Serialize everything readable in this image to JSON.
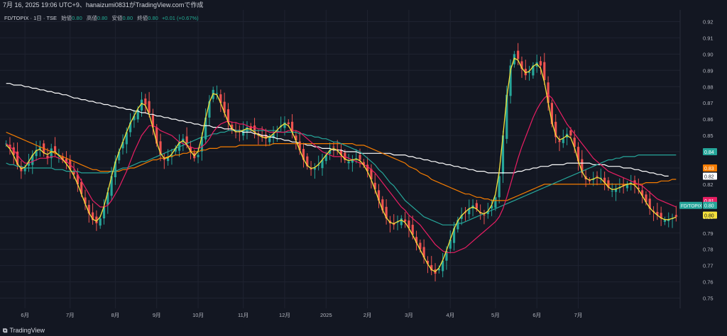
{
  "header": {
    "title": "7月 16, 2025 19:06 UTC+9、hanaizumi0831がTradingView.comで作成"
  },
  "legend": {
    "symbol": "FD/TOPIX · 1日 · TSE",
    "open_label": "始値",
    "open_value": "0.80",
    "high_label": "高値",
    "high_value": "0.80",
    "low_label": "安値",
    "low_value": "0.80",
    "close_label": "終値",
    "close_value": "0.80",
    "change": "+0.01 (+0.67%)"
  },
  "footer": {
    "brand": "TradingView",
    "icon": "tradingview-logo-icon"
  },
  "colors": {
    "background": "#131722",
    "grid": "#1f2330",
    "up": "#26a69a",
    "down": "#ef5350",
    "ma5": "#f5e13c",
    "ma25": "#e91e63",
    "ma75": "#26a69a",
    "ma100": "#f57c00",
    "ma200": "#ffffff"
  },
  "chart_data": {
    "type": "candlestick",
    "ylim": [
      0.745,
      0.925
    ],
    "yticks": [
      "0.92",
      "0.91",
      "0.90",
      "0.89",
      "0.88",
      "0.87",
      "0.86",
      "0.85",
      "0.84",
      "0.83",
      "0.82",
      "0.81",
      "0.80",
      "0.79",
      "0.78",
      "0.77",
      "0.76",
      "0.75"
    ],
    "xticks": [
      "6月",
      "7月",
      "8月",
      "9月",
      "10月",
      "11月",
      "12月",
      "2025",
      "2月",
      "3月",
      "4月",
      "5月",
      "6月",
      "7月"
    ],
    "closes": [
      0.845,
      0.842,
      0.838,
      0.832,
      0.828,
      0.83,
      0.834,
      0.838,
      0.841,
      0.843,
      0.839,
      0.836,
      0.842,
      0.84,
      0.838,
      0.835,
      0.833,
      0.829,
      0.826,
      0.82,
      0.814,
      0.808,
      0.802,
      0.798,
      0.796,
      0.799,
      0.806,
      0.815,
      0.825,
      0.834,
      0.84,
      0.846,
      0.852,
      0.858,
      0.862,
      0.866,
      0.872,
      0.869,
      0.864,
      0.855,
      0.845,
      0.838,
      0.835,
      0.836,
      0.838,
      0.842,
      0.846,
      0.848,
      0.845,
      0.84,
      0.836,
      0.838,
      0.849,
      0.861,
      0.871,
      0.878,
      0.876,
      0.87,
      0.864,
      0.858,
      0.853,
      0.852,
      0.852,
      0.853,
      0.855,
      0.854,
      0.852,
      0.85,
      0.849,
      0.848,
      0.849,
      0.851,
      0.853,
      0.856,
      0.858,
      0.857,
      0.852,
      0.847,
      0.841,
      0.835,
      0.831,
      0.829,
      0.83,
      0.832,
      0.835,
      0.838,
      0.841,
      0.843,
      0.841,
      0.838,
      0.835,
      0.834,
      0.835,
      0.836,
      0.835,
      0.832,
      0.828,
      0.823,
      0.817,
      0.81,
      0.804,
      0.799,
      0.796,
      0.795,
      0.797,
      0.799,
      0.797,
      0.793,
      0.789,
      0.784,
      0.78,
      0.775,
      0.771,
      0.767,
      0.765,
      0.768,
      0.773,
      0.779,
      0.786,
      0.793,
      0.798,
      0.801,
      0.803,
      0.805,
      0.807,
      0.805,
      0.802,
      0.801,
      0.803,
      0.807,
      0.812,
      0.825,
      0.85,
      0.875,
      0.893,
      0.9,
      0.897,
      0.891,
      0.887,
      0.889,
      0.893,
      0.895,
      0.893,
      0.884,
      0.87,
      0.857,
      0.849,
      0.846,
      0.848,
      0.851,
      0.85,
      0.843,
      0.834,
      0.827,
      0.823,
      0.822,
      0.823,
      0.825,
      0.824,
      0.821,
      0.818,
      0.816,
      0.817,
      0.818,
      0.819,
      0.82,
      0.821,
      0.82,
      0.817,
      0.813,
      0.809,
      0.805,
      0.803,
      0.801,
      0.799,
      0.798,
      0.798,
      0.799,
      0.8
    ],
    "series": [
      {
        "name": "",
        "color": "#e91e63",
        "values": [
          0.845,
          0.843,
          0.841,
          0.838,
          0.835,
          0.833,
          0.833,
          0.834,
          0.835,
          0.836,
          0.836,
          0.836,
          0.837,
          0.837,
          0.836,
          0.835,
          0.834,
          0.832,
          0.83,
          0.826,
          0.822,
          0.818,
          0.814,
          0.81,
          0.808,
          0.806,
          0.806,
          0.807,
          0.81,
          0.814,
          0.818,
          0.823,
          0.828,
          0.834,
          0.84,
          0.845,
          0.85,
          0.853,
          0.856,
          0.856,
          0.855,
          0.853,
          0.852,
          0.851,
          0.85,
          0.848,
          0.846,
          0.845,
          0.844,
          0.843,
          0.842,
          0.842,
          0.843,
          0.845,
          0.848,
          0.852,
          0.855,
          0.857,
          0.858,
          0.859,
          0.858,
          0.858,
          0.857,
          0.857,
          0.856,
          0.855,
          0.855,
          0.854,
          0.854,
          0.853,
          0.852,
          0.852,
          0.852,
          0.852,
          0.852,
          0.853,
          0.853,
          0.853,
          0.852,
          0.85,
          0.848,
          0.846,
          0.844,
          0.842,
          0.84,
          0.839,
          0.838,
          0.837,
          0.837,
          0.837,
          0.837,
          0.836,
          0.835,
          0.834,
          0.833,
          0.832,
          0.831,
          0.829,
          0.827,
          0.824,
          0.821,
          0.818,
          0.815,
          0.812,
          0.809,
          0.806,
          0.804,
          0.801,
          0.799,
          0.797,
          0.795,
          0.792,
          0.789,
          0.786,
          0.783,
          0.781,
          0.779,
          0.778,
          0.778,
          0.778,
          0.779,
          0.78,
          0.781,
          0.783,
          0.785,
          0.787,
          0.789,
          0.791,
          0.793,
          0.795,
          0.797,
          0.8,
          0.805,
          0.812,
          0.82,
          0.828,
          0.836,
          0.843,
          0.849,
          0.855,
          0.861,
          0.866,
          0.87,
          0.873,
          0.875,
          0.873,
          0.869,
          0.865,
          0.861,
          0.857,
          0.854,
          0.851,
          0.848,
          0.845,
          0.842,
          0.839,
          0.836,
          0.834,
          0.832,
          0.83,
          0.828,
          0.827,
          0.826,
          0.825,
          0.824,
          0.823,
          0.822,
          0.821,
          0.82,
          0.819,
          0.817,
          0.815,
          0.813,
          0.811,
          0.81,
          0.809,
          0.808,
          0.807,
          0.806
        ]
      },
      {
        "name": "",
        "color": "#26a69a",
        "values": [
          0.833,
          0.832,
          0.832,
          0.831,
          0.831,
          0.83,
          0.83,
          0.83,
          0.83,
          0.83,
          0.83,
          0.83,
          0.83,
          0.829,
          0.829,
          0.829,
          0.828,
          0.828,
          0.828,
          0.828,
          0.827,
          0.827,
          0.827,
          0.827,
          0.827,
          0.827,
          0.827,
          0.827,
          0.828,
          0.828,
          0.829,
          0.83,
          0.83,
          0.831,
          0.832,
          0.833,
          0.834,
          0.834,
          0.835,
          0.836,
          0.837,
          0.838,
          0.839,
          0.84,
          0.841,
          0.842,
          0.843,
          0.844,
          0.845,
          0.846,
          0.847,
          0.848,
          0.849,
          0.849,
          0.85,
          0.851,
          0.851,
          0.852,
          0.852,
          0.853,
          0.853,
          0.853,
          0.853,
          0.853,
          0.853,
          0.853,
          0.853,
          0.853,
          0.853,
          0.853,
          0.853,
          0.853,
          0.853,
          0.852,
          0.852,
          0.852,
          0.852,
          0.852,
          0.851,
          0.851,
          0.85,
          0.85,
          0.849,
          0.849,
          0.848,
          0.848,
          0.847,
          0.846,
          0.846,
          0.845,
          0.844,
          0.843,
          0.842,
          0.841,
          0.84,
          0.838,
          0.836,
          0.834,
          0.832,
          0.829,
          0.827,
          0.824,
          0.821,
          0.819,
          0.816,
          0.813,
          0.81,
          0.808,
          0.806,
          0.804,
          0.802,
          0.8,
          0.799,
          0.798,
          0.797,
          0.796,
          0.795,
          0.795,
          0.795,
          0.795,
          0.796,
          0.796,
          0.797,
          0.798,
          0.799,
          0.8,
          0.801,
          0.802,
          0.803,
          0.804,
          0.805,
          0.806,
          0.807,
          0.808,
          0.809,
          0.81,
          0.811,
          0.812,
          0.813,
          0.814,
          0.815,
          0.816,
          0.817,
          0.818,
          0.819,
          0.82,
          0.821,
          0.822,
          0.823,
          0.824,
          0.825,
          0.826,
          0.827,
          0.828,
          0.829,
          0.83,
          0.831,
          0.832,
          0.833,
          0.834,
          0.835,
          0.835,
          0.836,
          0.836,
          0.837,
          0.837,
          0.837,
          0.837,
          0.838,
          0.838,
          0.838,
          0.838,
          0.838,
          0.838,
          0.838,
          0.838,
          0.838,
          0.838,
          0.838
        ]
      },
      {
        "name": "",
        "color": "#f57c00",
        "values": [
          0.852,
          0.851,
          0.85,
          0.849,
          0.848,
          0.847,
          0.846,
          0.845,
          0.844,
          0.843,
          0.842,
          0.841,
          0.84,
          0.839,
          0.838,
          0.837,
          0.836,
          0.835,
          0.834,
          0.833,
          0.832,
          0.831,
          0.83,
          0.829,
          0.829,
          0.828,
          0.828,
          0.828,
          0.828,
          0.828,
          0.828,
          0.829,
          0.829,
          0.83,
          0.83,
          0.831,
          0.832,
          0.833,
          0.834,
          0.835,
          0.835,
          0.836,
          0.836,
          0.837,
          0.837,
          0.838,
          0.838,
          0.839,
          0.839,
          0.84,
          0.84,
          0.84,
          0.841,
          0.841,
          0.842,
          0.842,
          0.842,
          0.843,
          0.843,
          0.843,
          0.843,
          0.843,
          0.844,
          0.844,
          0.844,
          0.844,
          0.844,
          0.844,
          0.844,
          0.844,
          0.844,
          0.845,
          0.845,
          0.845,
          0.845,
          0.845,
          0.845,
          0.845,
          0.845,
          0.845,
          0.845,
          0.845,
          0.845,
          0.845,
          0.845,
          0.845,
          0.845,
          0.845,
          0.845,
          0.845,
          0.845,
          0.845,
          0.845,
          0.844,
          0.844,
          0.844,
          0.843,
          0.842,
          0.841,
          0.84,
          0.839,
          0.838,
          0.837,
          0.836,
          0.835,
          0.834,
          0.833,
          0.831,
          0.83,
          0.829,
          0.827,
          0.826,
          0.825,
          0.823,
          0.822,
          0.821,
          0.82,
          0.819,
          0.818,
          0.817,
          0.816,
          0.815,
          0.814,
          0.814,
          0.813,
          0.812,
          0.812,
          0.811,
          0.811,
          0.81,
          0.81,
          0.81,
          0.81,
          0.81,
          0.811,
          0.812,
          0.813,
          0.814,
          0.815,
          0.816,
          0.817,
          0.818,
          0.819,
          0.82,
          0.82,
          0.82,
          0.82,
          0.82,
          0.82,
          0.82,
          0.82,
          0.82,
          0.82,
          0.82,
          0.82,
          0.82,
          0.82,
          0.82,
          0.82,
          0.82,
          0.82,
          0.82,
          0.82,
          0.82,
          0.82,
          0.82,
          0.82,
          0.82,
          0.82,
          0.82,
          0.821,
          0.821,
          0.821,
          0.821,
          0.822,
          0.822,
          0.822,
          0.823,
          0.823
        ]
      },
      {
        "name": "",
        "color": "#ffffff",
        "values": [
          0.882,
          0.882,
          0.881,
          0.881,
          0.881,
          0.88,
          0.88,
          0.879,
          0.879,
          0.878,
          0.878,
          0.877,
          0.877,
          0.876,
          0.876,
          0.875,
          0.875,
          0.874,
          0.873,
          0.873,
          0.872,
          0.872,
          0.871,
          0.871,
          0.87,
          0.87,
          0.869,
          0.869,
          0.868,
          0.868,
          0.867,
          0.867,
          0.866,
          0.866,
          0.865,
          0.865,
          0.864,
          0.864,
          0.863,
          0.863,
          0.862,
          0.862,
          0.861,
          0.861,
          0.86,
          0.86,
          0.859,
          0.859,
          0.858,
          0.858,
          0.857,
          0.857,
          0.856,
          0.856,
          0.856,
          0.855,
          0.855,
          0.855,
          0.854,
          0.854,
          0.854,
          0.853,
          0.853,
          0.852,
          0.852,
          0.852,
          0.851,
          0.851,
          0.85,
          0.85,
          0.849,
          0.849,
          0.848,
          0.848,
          0.847,
          0.847,
          0.846,
          0.846,
          0.845,
          0.845,
          0.844,
          0.844,
          0.843,
          0.843,
          0.842,
          0.842,
          0.842,
          0.841,
          0.841,
          0.841,
          0.84,
          0.84,
          0.84,
          0.84,
          0.839,
          0.839,
          0.839,
          0.839,
          0.839,
          0.839,
          0.839,
          0.839,
          0.839,
          0.838,
          0.838,
          0.838,
          0.838,
          0.837,
          0.837,
          0.836,
          0.836,
          0.835,
          0.835,
          0.834,
          0.834,
          0.833,
          0.833,
          0.832,
          0.832,
          0.831,
          0.831,
          0.83,
          0.83,
          0.829,
          0.829,
          0.828,
          0.828,
          0.828,
          0.827,
          0.827,
          0.827,
          0.827,
          0.827,
          0.827,
          0.827,
          0.827,
          0.828,
          0.828,
          0.829,
          0.829,
          0.83,
          0.83,
          0.831,
          0.831,
          0.831,
          0.832,
          0.832,
          0.832,
          0.832,
          0.833,
          0.833,
          0.833,
          0.833,
          0.833,
          0.833,
          0.833,
          0.832,
          0.832,
          0.832,
          0.832,
          0.831,
          0.831,
          0.831,
          0.831,
          0.83,
          0.83,
          0.83,
          0.829,
          0.829,
          0.828,
          0.828,
          0.827,
          0.827,
          0.826,
          0.826,
          0.825,
          0.825
        ]
      }
    ],
    "price_labels": [
      {
        "value": 0.84,
        "text": "0.84",
        "color": "#26a69a"
      },
      {
        "value": 0.83,
        "text": "0.83",
        "color": "#f57c00"
      },
      {
        "value": 0.825,
        "text": "0.82",
        "color": "#ffffff"
      },
      {
        "value": 0.81,
        "text": "0.81",
        "color": "#e91e63"
      },
      {
        "value": 0.807,
        "text": "0.80",
        "color": "#26a69a",
        "prefix": "FD/TOPIX"
      },
      {
        "value": 0.801,
        "text": "0.80",
        "color": "#f5e13c"
      }
    ]
  }
}
